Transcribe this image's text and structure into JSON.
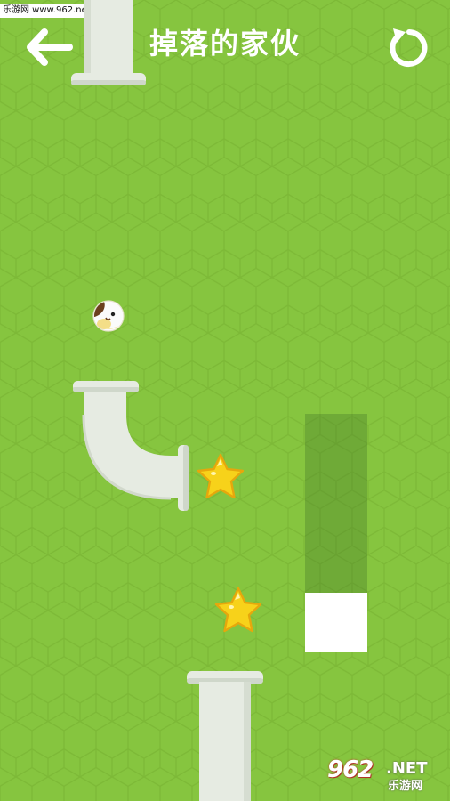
{
  "watermark": {
    "text": "乐游网 www.962.net"
  },
  "header": {
    "title": "掉落的家伙",
    "back_icon": "arrow-left-icon",
    "restart_icon": "restart-icon"
  },
  "gauge": {
    "fill_fraction": 0.25
  },
  "logo": {
    "main": "962",
    "suffix": ".NET",
    "sub": "乐游网"
  },
  "colors": {
    "background": "#86c53f",
    "hex_pattern": "#7dbb37",
    "pipe": "#e6ebe2",
    "pipe_shadow": "#c9d1c3",
    "star": "#f7d21a",
    "star_outline": "#e6a70c",
    "gauge_bg": "#6a9f3c",
    "gauge_fill": "#ffffff",
    "ball_face": "#fbfbfb",
    "ball_patch": "#6b3f1e"
  },
  "icons": [
    "arrow-left-icon",
    "restart-icon",
    "star-icon",
    "ball-character",
    "pipe-icon"
  ]
}
